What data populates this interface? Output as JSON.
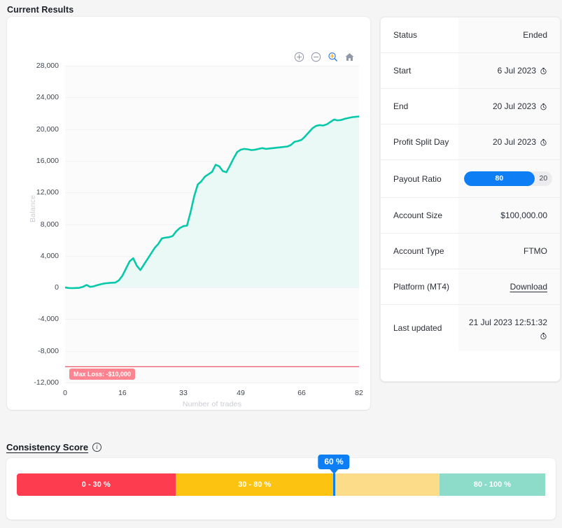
{
  "headings": {
    "results": "Current Results",
    "consistency": "Consistency Score",
    "info_icon": "info-icon"
  },
  "chart_toolbar": {
    "zoom_in": "zoom-in-icon",
    "zoom_out": "zoom-out-icon",
    "selection_zoom": "selection-zoom-icon",
    "reset": "home-icon"
  },
  "chart_data": {
    "type": "area",
    "title": "",
    "xlabel": "Number of trades",
    "ylabel": "Balance",
    "xticks": [
      "0",
      "16",
      "33",
      "49",
      "66",
      "82"
    ],
    "xtick_values": [
      0,
      16,
      33,
      49,
      66,
      82
    ],
    "yticks": [
      "28,000",
      "24,000",
      "20,000",
      "16,000",
      "12,000",
      "8,000",
      "4,000",
      "0",
      "-4,000",
      "-8,000",
      "-12,000"
    ],
    "ytick_values": [
      28000,
      24000,
      20000,
      16000,
      12000,
      8000,
      4000,
      0,
      -4000,
      -8000,
      -12000
    ],
    "xlim": [
      0,
      82
    ],
    "ylim": [
      -12000,
      28000
    ],
    "grid": true,
    "line_color": "#07c8a8",
    "fill_color": "#eaf9f6",
    "threshold": {
      "label": "Max Loss: -$10,000",
      "value": -10000,
      "color": "#f1566c",
      "badge_color": "#fd8490"
    },
    "series": [
      {
        "name": "Balance",
        "x": [
          0,
          1,
          2,
          3,
          4,
          5,
          6,
          7,
          8,
          9,
          10,
          11,
          12,
          13,
          14,
          15,
          16,
          17,
          18,
          19,
          20,
          21,
          22,
          23,
          24,
          25,
          26,
          27,
          28,
          29,
          30,
          31,
          32,
          33,
          34,
          35,
          36,
          37,
          38,
          39,
          40,
          41,
          42,
          43,
          44,
          45,
          46,
          47,
          48,
          49,
          50,
          51,
          52,
          53,
          54,
          55,
          56,
          57,
          58,
          59,
          60,
          61,
          62,
          63,
          64,
          65,
          66,
          67,
          68,
          69,
          70,
          71,
          72,
          73,
          74,
          75,
          76,
          77,
          78,
          79,
          80,
          81,
          82
        ],
        "y": [
          0,
          -60,
          -80,
          -60,
          -40,
          90,
          320,
          80,
          150,
          300,
          420,
          520,
          560,
          600,
          620,
          900,
          1500,
          2400,
          3300,
          3700,
          2750,
          2200,
          2900,
          3600,
          4300,
          5000,
          5500,
          6200,
          6300,
          6350,
          6500,
          7100,
          7500,
          7750,
          7800,
          9500,
          11500,
          13000,
          13400,
          14000,
          14300,
          14600,
          15500,
          15300,
          14700,
          14550,
          15400,
          16300,
          17100,
          17400,
          17500,
          17450,
          17350,
          17400,
          17500,
          17600,
          17500,
          17550,
          17600,
          17650,
          17700,
          17750,
          17800,
          18000,
          18400,
          18500,
          18650,
          19100,
          19600,
          20100,
          20400,
          20500,
          20450,
          20600,
          20900,
          21200,
          21100,
          21150,
          21300,
          21400,
          21500,
          21550,
          21600
        ]
      }
    ]
  },
  "details": {
    "rows": [
      {
        "label": "Status",
        "value": "Ended",
        "icon": null,
        "type": "text"
      },
      {
        "label": "Start",
        "value": "6 Jul 2023",
        "icon": "clock-icon",
        "type": "text"
      },
      {
        "label": "End",
        "value": "20 Jul 2023",
        "icon": "clock-icon",
        "type": "text"
      },
      {
        "label": "Profit Split Day",
        "value": "20 Jul 2023",
        "icon": "clock-icon",
        "type": "text"
      },
      {
        "label": "Payout Ratio",
        "value": "80",
        "secondary": "20",
        "type": "ratio"
      },
      {
        "label": "Account Size",
        "value": "$100,000.00",
        "icon": null,
        "type": "text"
      },
      {
        "label": "Account Type",
        "value": "FTMO",
        "icon": null,
        "type": "text"
      },
      {
        "label": "Platform (MT4)",
        "value": "Download",
        "icon": null,
        "type": "link"
      },
      {
        "label": "Last updated",
        "value": "21 Jul 2023 12:51:32",
        "icon": "clock-icon",
        "type": "text"
      }
    ]
  },
  "consistency": {
    "marker_label": "60 %",
    "marker_value": 60,
    "segments": [
      {
        "label": "0 - 30 %",
        "from": 0,
        "to": 30,
        "color": "#fd3d4f"
      },
      {
        "label": "30 - 80 %",
        "from": 30,
        "to": 60,
        "color": "#fcc310"
      },
      {
        "label": "",
        "from": 60,
        "to": 80,
        "color": "#fcdc88"
      },
      {
        "label": "80 - 100 %",
        "from": 80,
        "to": 100,
        "color": "#8ddcca"
      }
    ],
    "marker_color": "#0d7ef4"
  },
  "colors": {
    "accent_blue": "#0d7ef4",
    "teal": "#07c8a8",
    "red": "#fd3d4f",
    "yellow": "#fcc310",
    "page_bg": "#f5f5f5"
  }
}
